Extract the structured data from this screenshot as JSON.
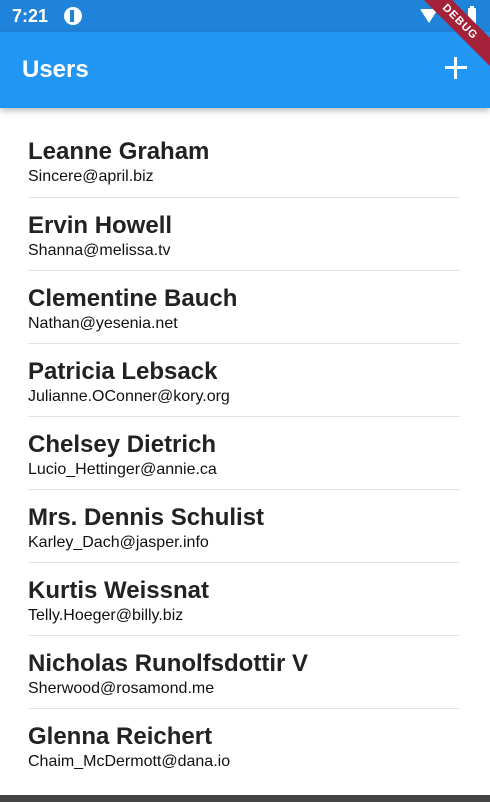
{
  "status_bar": {
    "time": "7:21"
  },
  "app_bar": {
    "title": "Users",
    "action_icon": "add-icon"
  },
  "debug_banner": "DEBUG",
  "users": [
    {
      "name": "Leanne Graham",
      "email": "Sincere@april.biz"
    },
    {
      "name": "Ervin Howell",
      "email": "Shanna@melissa.tv"
    },
    {
      "name": "Clementine Bauch",
      "email": "Nathan@yesenia.net"
    },
    {
      "name": "Patricia Lebsack",
      "email": "Julianne.OConner@kory.org"
    },
    {
      "name": "Chelsey Dietrich",
      "email": "Lucio_Hettinger@annie.ca"
    },
    {
      "name": "Mrs. Dennis Schulist",
      "email": "Karley_Dach@jasper.info"
    },
    {
      "name": "Kurtis Weissnat",
      "email": "Telly.Hoeger@billy.biz"
    },
    {
      "name": "Nicholas Runolfsdottir V",
      "email": "Sherwood@rosamond.me"
    },
    {
      "name": "Glenna Reichert",
      "email": "Chaim_McDermott@dana.io"
    }
  ],
  "colors": {
    "app_bar": "#2196f3",
    "status_bar": "#1f83d9",
    "debug": "#a3223a"
  }
}
